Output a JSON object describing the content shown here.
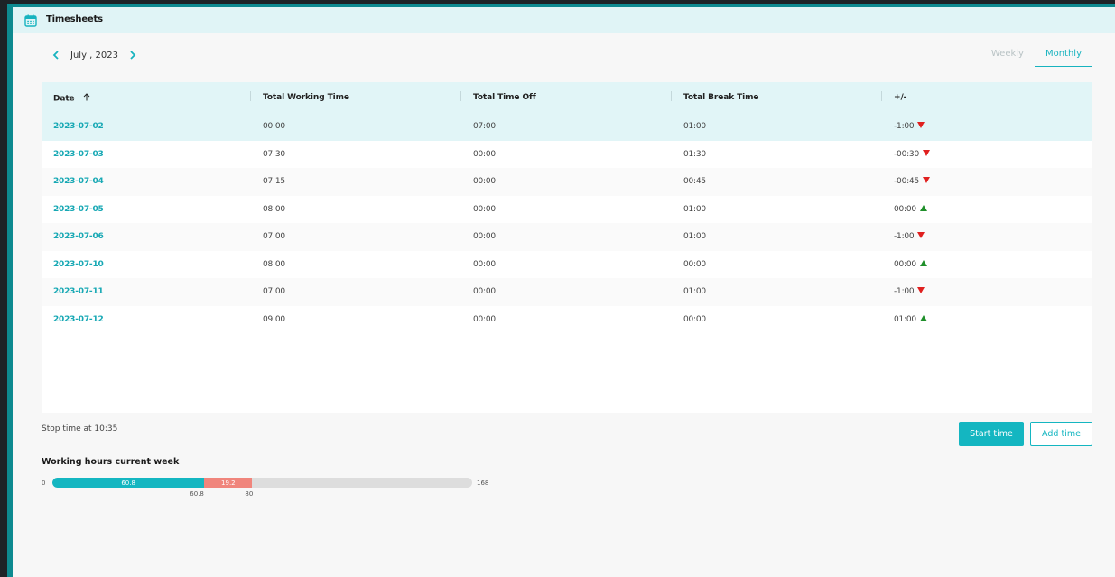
{
  "window": {
    "title": "Timesheets",
    "icon": "calendar-icon"
  },
  "nav": {
    "month_label": "July , 2023",
    "prev_icon": "chevron-left-icon",
    "next_icon": "chevron-right-icon"
  },
  "view_tabs": [
    {
      "label": "Weekly",
      "active": false
    },
    {
      "label": "Monthly",
      "active": true
    }
  ],
  "table": {
    "columns": [
      {
        "label": "Date",
        "sort_icon": "arrow-up-icon"
      },
      {
        "label": "Total Working Time"
      },
      {
        "label": "Total Time Off"
      },
      {
        "label": "Total Break Time"
      },
      {
        "label": "+/-"
      }
    ],
    "rows": [
      {
        "date": "2023-07-02",
        "working": "00:00",
        "off": "07:00",
        "break": "01:00",
        "diff": "-1:00",
        "trend": "down"
      },
      {
        "date": "2023-07-03",
        "working": "07:30",
        "off": "00:00",
        "break": "01:30",
        "diff": "-00:30",
        "trend": "down"
      },
      {
        "date": "2023-07-04",
        "working": "07:15",
        "off": "00:00",
        "break": "00:45",
        "diff": "-00:45",
        "trend": "down"
      },
      {
        "date": "2023-07-05",
        "working": "08:00",
        "off": "00:00",
        "break": "01:00",
        "diff": "00:00",
        "trend": "up"
      },
      {
        "date": "2023-07-06",
        "working": "07:00",
        "off": "00:00",
        "break": "01:00",
        "diff": "-1:00",
        "trend": "down"
      },
      {
        "date": "2023-07-10",
        "working": "08:00",
        "off": "00:00",
        "break": "00:00",
        "diff": "00:00",
        "trend": "up"
      },
      {
        "date": "2023-07-11",
        "working": "07:00",
        "off": "00:00",
        "break": "01:00",
        "diff": "-1:00",
        "trend": "down"
      },
      {
        "date": "2023-07-12",
        "working": "09:00",
        "off": "00:00",
        "break": "00:00",
        "diff": "01:00",
        "trend": "up"
      }
    ]
  },
  "footer": {
    "stop_text": "Stop time at 10:35",
    "start_button": "Start time",
    "add_button": "Add time"
  },
  "working_hours": {
    "title": "Working hours current week",
    "min_label": "0",
    "max_label": "168",
    "max_value": 168,
    "worked_value": 60.8,
    "worked_label": "60.8",
    "remaining_value": 19.2,
    "remaining_label": "19.2",
    "marker_labels": [
      "60.8",
      "80"
    ]
  },
  "colors": {
    "accent": "#14b6c1",
    "header_bg": "#e1f5f7",
    "down": "#e0201f",
    "up": "#1f8f2a",
    "remaining": "#f0857c"
  }
}
